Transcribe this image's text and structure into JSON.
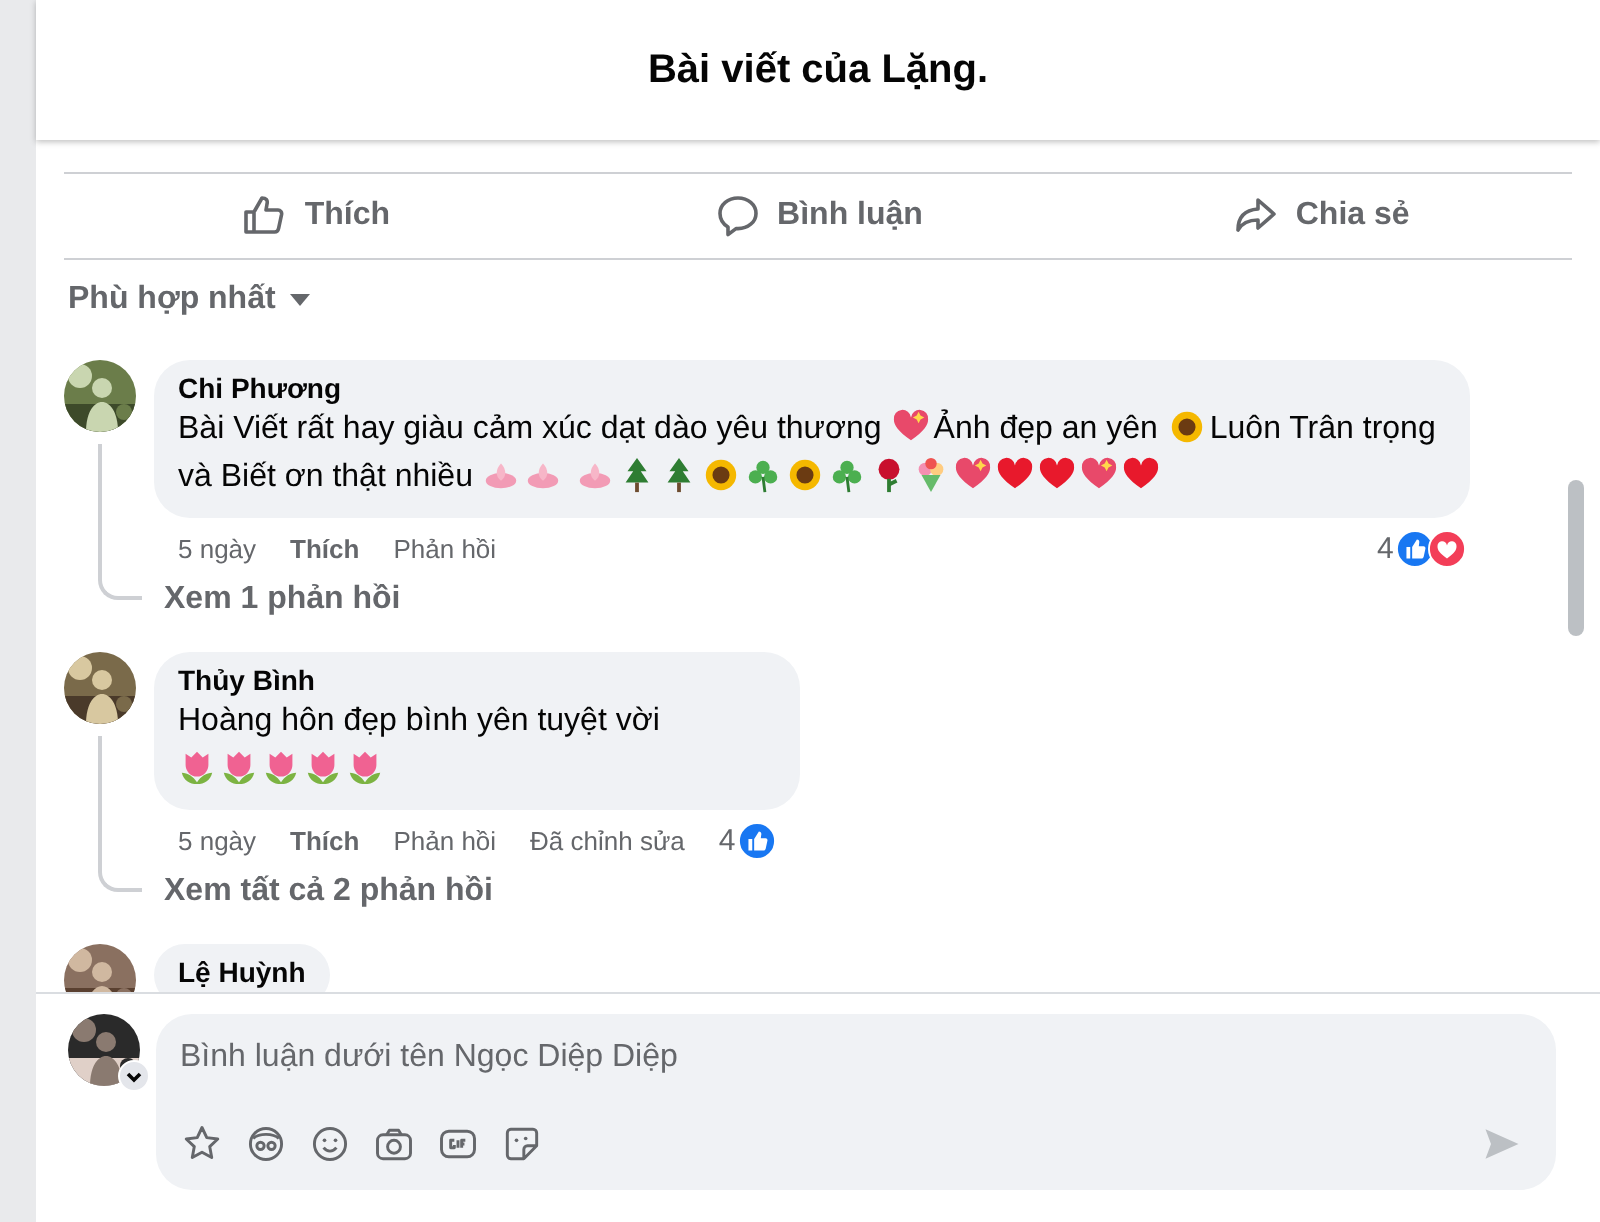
{
  "header": {
    "title": "Bài viết của Lặng."
  },
  "actions": [
    {
      "kind": "like",
      "label": "Thích"
    },
    {
      "kind": "comment",
      "label": "Bình luận"
    },
    {
      "kind": "share",
      "label": "Chia sẻ"
    }
  ],
  "sort": {
    "label": "Phù hợp nhất"
  },
  "comments": [
    {
      "author": "Chi Phương",
      "body": [
        {
          "kind": "text",
          "text": "Bài Viết rất hay giàu cảm xúc dạt dào yêu thương"
        },
        {
          "kind": "sparkleheart"
        },
        {
          "kind": "text",
          "text": "Ảnh đẹp an yên"
        },
        {
          "kind": "sunflower"
        },
        {
          "kind": "text",
          "text": "Luôn Trân trọng"
        },
        {
          "kind": "break"
        },
        {
          "kind": "text",
          "text": "và Biết ơn thật nhiều"
        },
        {
          "kind": "lotus"
        },
        {
          "kind": "lotus"
        },
        {
          "kind": "space"
        },
        {
          "kind": "lotus"
        },
        {
          "kind": "tree"
        },
        {
          "kind": "tree"
        },
        {
          "kind": "sunflower"
        },
        {
          "kind": "clover"
        },
        {
          "kind": "sunflower"
        },
        {
          "kind": "clover"
        },
        {
          "kind": "rose"
        },
        {
          "kind": "bouquet"
        },
        {
          "kind": "sparkleheart"
        },
        {
          "kind": "heart"
        },
        {
          "kind": "heart"
        },
        {
          "kind": "sparkleheart"
        },
        {
          "kind": "heart"
        }
      ],
      "time": "5 ngày",
      "like": "Thích",
      "reply": "Phản hồi",
      "reaction_count": "4",
      "reactions": [
        {
          "kind": "like"
        },
        {
          "kind": "love"
        }
      ],
      "replies_link": "Xem 1 phản hồi"
    },
    {
      "author": "Thủy Bình",
      "body": [
        {
          "kind": "text",
          "text": "Hoàng hôn đẹp bình yên tuyệt vời"
        },
        {
          "kind": "break"
        },
        {
          "kind": "tulip"
        },
        {
          "kind": "tulip"
        },
        {
          "kind": "tulip"
        },
        {
          "kind": "tulip"
        },
        {
          "kind": "tulip"
        }
      ],
      "time": "5 ngày",
      "like": "Thích",
      "reply": "Phản hồi",
      "edited": "Đã chỉnh sửa",
      "reaction_count": "4",
      "reactions": [
        {
          "kind": "like"
        }
      ],
      "replies_link": "Xem tất cả 2 phản hồi"
    },
    {
      "author": "Lệ Huỳnh"
    }
  ],
  "composer": {
    "placeholder": "Bình luận dưới tên Ngọc Diệp Diệp"
  }
}
